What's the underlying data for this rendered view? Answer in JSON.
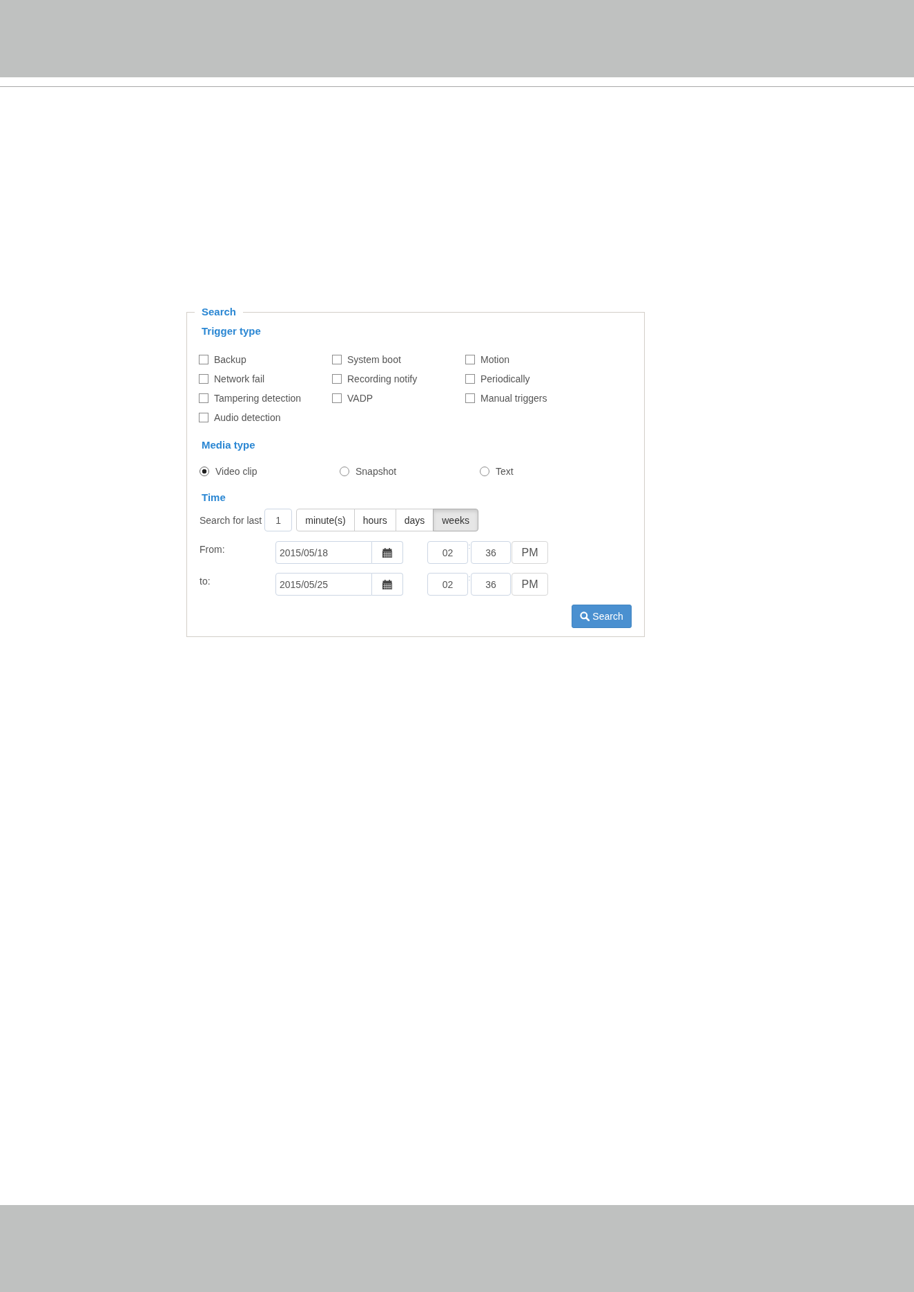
{
  "search_panel": {
    "title": "Search",
    "trigger_type": {
      "heading": "Trigger type",
      "options": [
        {
          "label": "Backup",
          "checked": false
        },
        {
          "label": "System boot",
          "checked": false
        },
        {
          "label": "Motion",
          "checked": false
        },
        {
          "label": "Network fail",
          "checked": false
        },
        {
          "label": "Recording notify",
          "checked": false
        },
        {
          "label": "Periodically",
          "checked": false
        },
        {
          "label": "Tampering detection",
          "checked": false
        },
        {
          "label": "VADP",
          "checked": false
        },
        {
          "label": "Manual triggers",
          "checked": false
        },
        {
          "label": "Audio detection",
          "checked": false
        }
      ]
    },
    "media_type": {
      "heading": "Media type",
      "options": [
        {
          "label": "Video clip",
          "selected": true
        },
        {
          "label": "Snapshot",
          "selected": false
        },
        {
          "label": "Text",
          "selected": false
        }
      ]
    },
    "time": {
      "heading": "Time",
      "last": {
        "label": "Search for last",
        "value": "1",
        "units": [
          {
            "label": "minute(s)",
            "selected": false
          },
          {
            "label": "hours",
            "selected": false
          },
          {
            "label": "days",
            "selected": false
          },
          {
            "label": "weeks",
            "selected": true
          }
        ]
      },
      "ranges": [
        {
          "label": "From:",
          "date": "2015/05/18",
          "hour": "02",
          "separator": ":",
          "minute": "36",
          "period": "PM"
        },
        {
          "label": "to:",
          "date": "2015/05/25",
          "hour": "02",
          "separator": ":",
          "minute": "36",
          "period": "PM"
        }
      ]
    },
    "search_button": {
      "label": "Search"
    }
  }
}
